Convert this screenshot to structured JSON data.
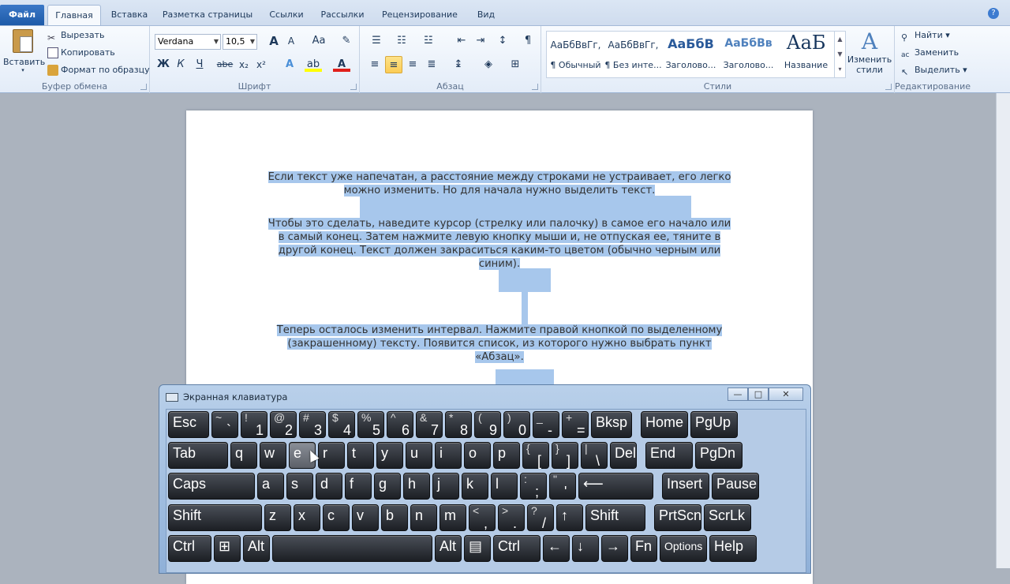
{
  "tabs": {
    "file": "Файл",
    "items": [
      "Главная",
      "Вставка",
      "Разметка страницы",
      "Ссылки",
      "Рассылки",
      "Рецензирование",
      "Вид"
    ]
  },
  "clipboard": {
    "paste": "Вставить",
    "cut": "Вырезать",
    "copy": "Копировать",
    "format_painter": "Формат по образцу",
    "label": "Буфер обмена"
  },
  "font": {
    "family": "Verdana",
    "size": "10,5",
    "grow": "A",
    "shrink": "A",
    "case": "Аа",
    "bold": "Ж",
    "italic": "К",
    "underline": "Ч",
    "strike": "abe",
    "subscript": "x₂",
    "superscript": "x²",
    "label": "Шрифт"
  },
  "paragraph": {
    "label": "Абзац",
    "pilcrow": "¶"
  },
  "styles": {
    "label": "Стили",
    "items": [
      {
        "preview": "АаБбВвГг,",
        "name": "¶ Обычный"
      },
      {
        "preview": "АаБбВвГг,",
        "name": "¶ Без инте..."
      },
      {
        "preview": "АаБбВ",
        "name": "Заголово..."
      },
      {
        "preview": "АаБбВв",
        "name": "Заголово..."
      },
      {
        "preview": "АаБ",
        "name": "Название"
      }
    ],
    "change": "Изменить стили"
  },
  "editing": {
    "find": "Найти",
    "replace": "Заменить",
    "select": "Выделить",
    "label": "Редактирование"
  },
  "document": {
    "para1_line1": "Если текст уже напечатан, а расстояние между строками не устраивает, его легко",
    "para1_line2": "можно изменить. Но для начала нужно выделить текст.",
    "para2_line1": "Чтобы это сделать, наведите курсор (стрелку или палочку) в самое его начало или",
    "para2_line2": "в самый конец. Затем нажмите левую кнопку мыши и, не отпуская ее, тяните в",
    "para2_line3": "другой конец. Текст должен закраситься каким-то цветом (обычно черным или",
    "para2_line4": "синим).",
    "para3_line1": "Теперь осталось изменить интервал. Нажмите правой кнопкой по выделенному",
    "para3_line2": "(закрашенному) тексту. Появится список, из которого нужно выбрать пункт",
    "para3_line3": "«Абзац»."
  },
  "osk": {
    "title": "Экранная клавиатура",
    "minimize": "—",
    "maximize": "□",
    "close": "✕",
    "row1": [
      {
        "m": "Esc"
      },
      {
        "t": "~",
        "b": "`"
      },
      {
        "t": "!",
        "b": "1"
      },
      {
        "t": "@",
        "b": "2"
      },
      {
        "t": "#",
        "b": "3"
      },
      {
        "t": "$",
        "b": "4"
      },
      {
        "t": "%",
        "b": "5"
      },
      {
        "t": "^",
        "b": "6"
      },
      {
        "t": "&",
        "b": "7"
      },
      {
        "t": "*",
        "b": "8"
      },
      {
        "t": "(",
        "b": "9"
      },
      {
        "t": ")",
        "b": "0"
      },
      {
        "t": "_",
        "b": "-"
      },
      {
        "t": "+",
        "b": "="
      },
      {
        "m": "Bksp"
      },
      {
        "m": "Home"
      },
      {
        "m": "PgUp"
      }
    ],
    "row2": [
      {
        "m": "Tab"
      },
      {
        "m": "q"
      },
      {
        "m": "w"
      },
      {
        "m": "e"
      },
      {
        "m": "r"
      },
      {
        "m": "t"
      },
      {
        "m": "y"
      },
      {
        "m": "u"
      },
      {
        "m": "i"
      },
      {
        "m": "o"
      },
      {
        "m": "p"
      },
      {
        "t": "{",
        "b": "["
      },
      {
        "t": "}",
        "b": "]"
      },
      {
        "t": "|",
        "b": "\\"
      },
      {
        "m": "Del"
      },
      {
        "m": "End"
      },
      {
        "m": "PgDn"
      }
    ],
    "row3": [
      {
        "m": "Caps"
      },
      {
        "m": "a"
      },
      {
        "m": "s"
      },
      {
        "m": "d"
      },
      {
        "m": "f"
      },
      {
        "m": "g"
      },
      {
        "m": "h"
      },
      {
        "m": "j"
      },
      {
        "m": "k"
      },
      {
        "m": "l"
      },
      {
        "t": ":",
        "b": ";"
      },
      {
        "t": "\"",
        "b": "'"
      },
      {
        "m": "⟵"
      },
      {
        "m": "Insert"
      },
      {
        "m": "Pause"
      }
    ],
    "row4": [
      {
        "m": "Shift"
      },
      {
        "m": "z"
      },
      {
        "m": "x"
      },
      {
        "m": "c"
      },
      {
        "m": "v"
      },
      {
        "m": "b"
      },
      {
        "m": "n"
      },
      {
        "m": "m"
      },
      {
        "t": "<",
        "b": ","
      },
      {
        "t": ">",
        "b": "."
      },
      {
        "t": "?",
        "b": "/"
      },
      {
        "m": "↑"
      },
      {
        "m": "Shift"
      },
      {
        "m": "PrtScn"
      },
      {
        "m": "ScrLk"
      }
    ],
    "row5": [
      {
        "m": "Ctrl"
      },
      {
        "m": "⊞"
      },
      {
        "m": "Alt"
      },
      {
        "m": ""
      },
      {
        "m": "Alt"
      },
      {
        "m": "▤"
      },
      {
        "m": "Ctrl"
      },
      {
        "m": "←"
      },
      {
        "m": "↓"
      },
      {
        "m": "→"
      },
      {
        "m": "Fn"
      },
      {
        "m": "Options"
      },
      {
        "m": "Help"
      }
    ]
  }
}
